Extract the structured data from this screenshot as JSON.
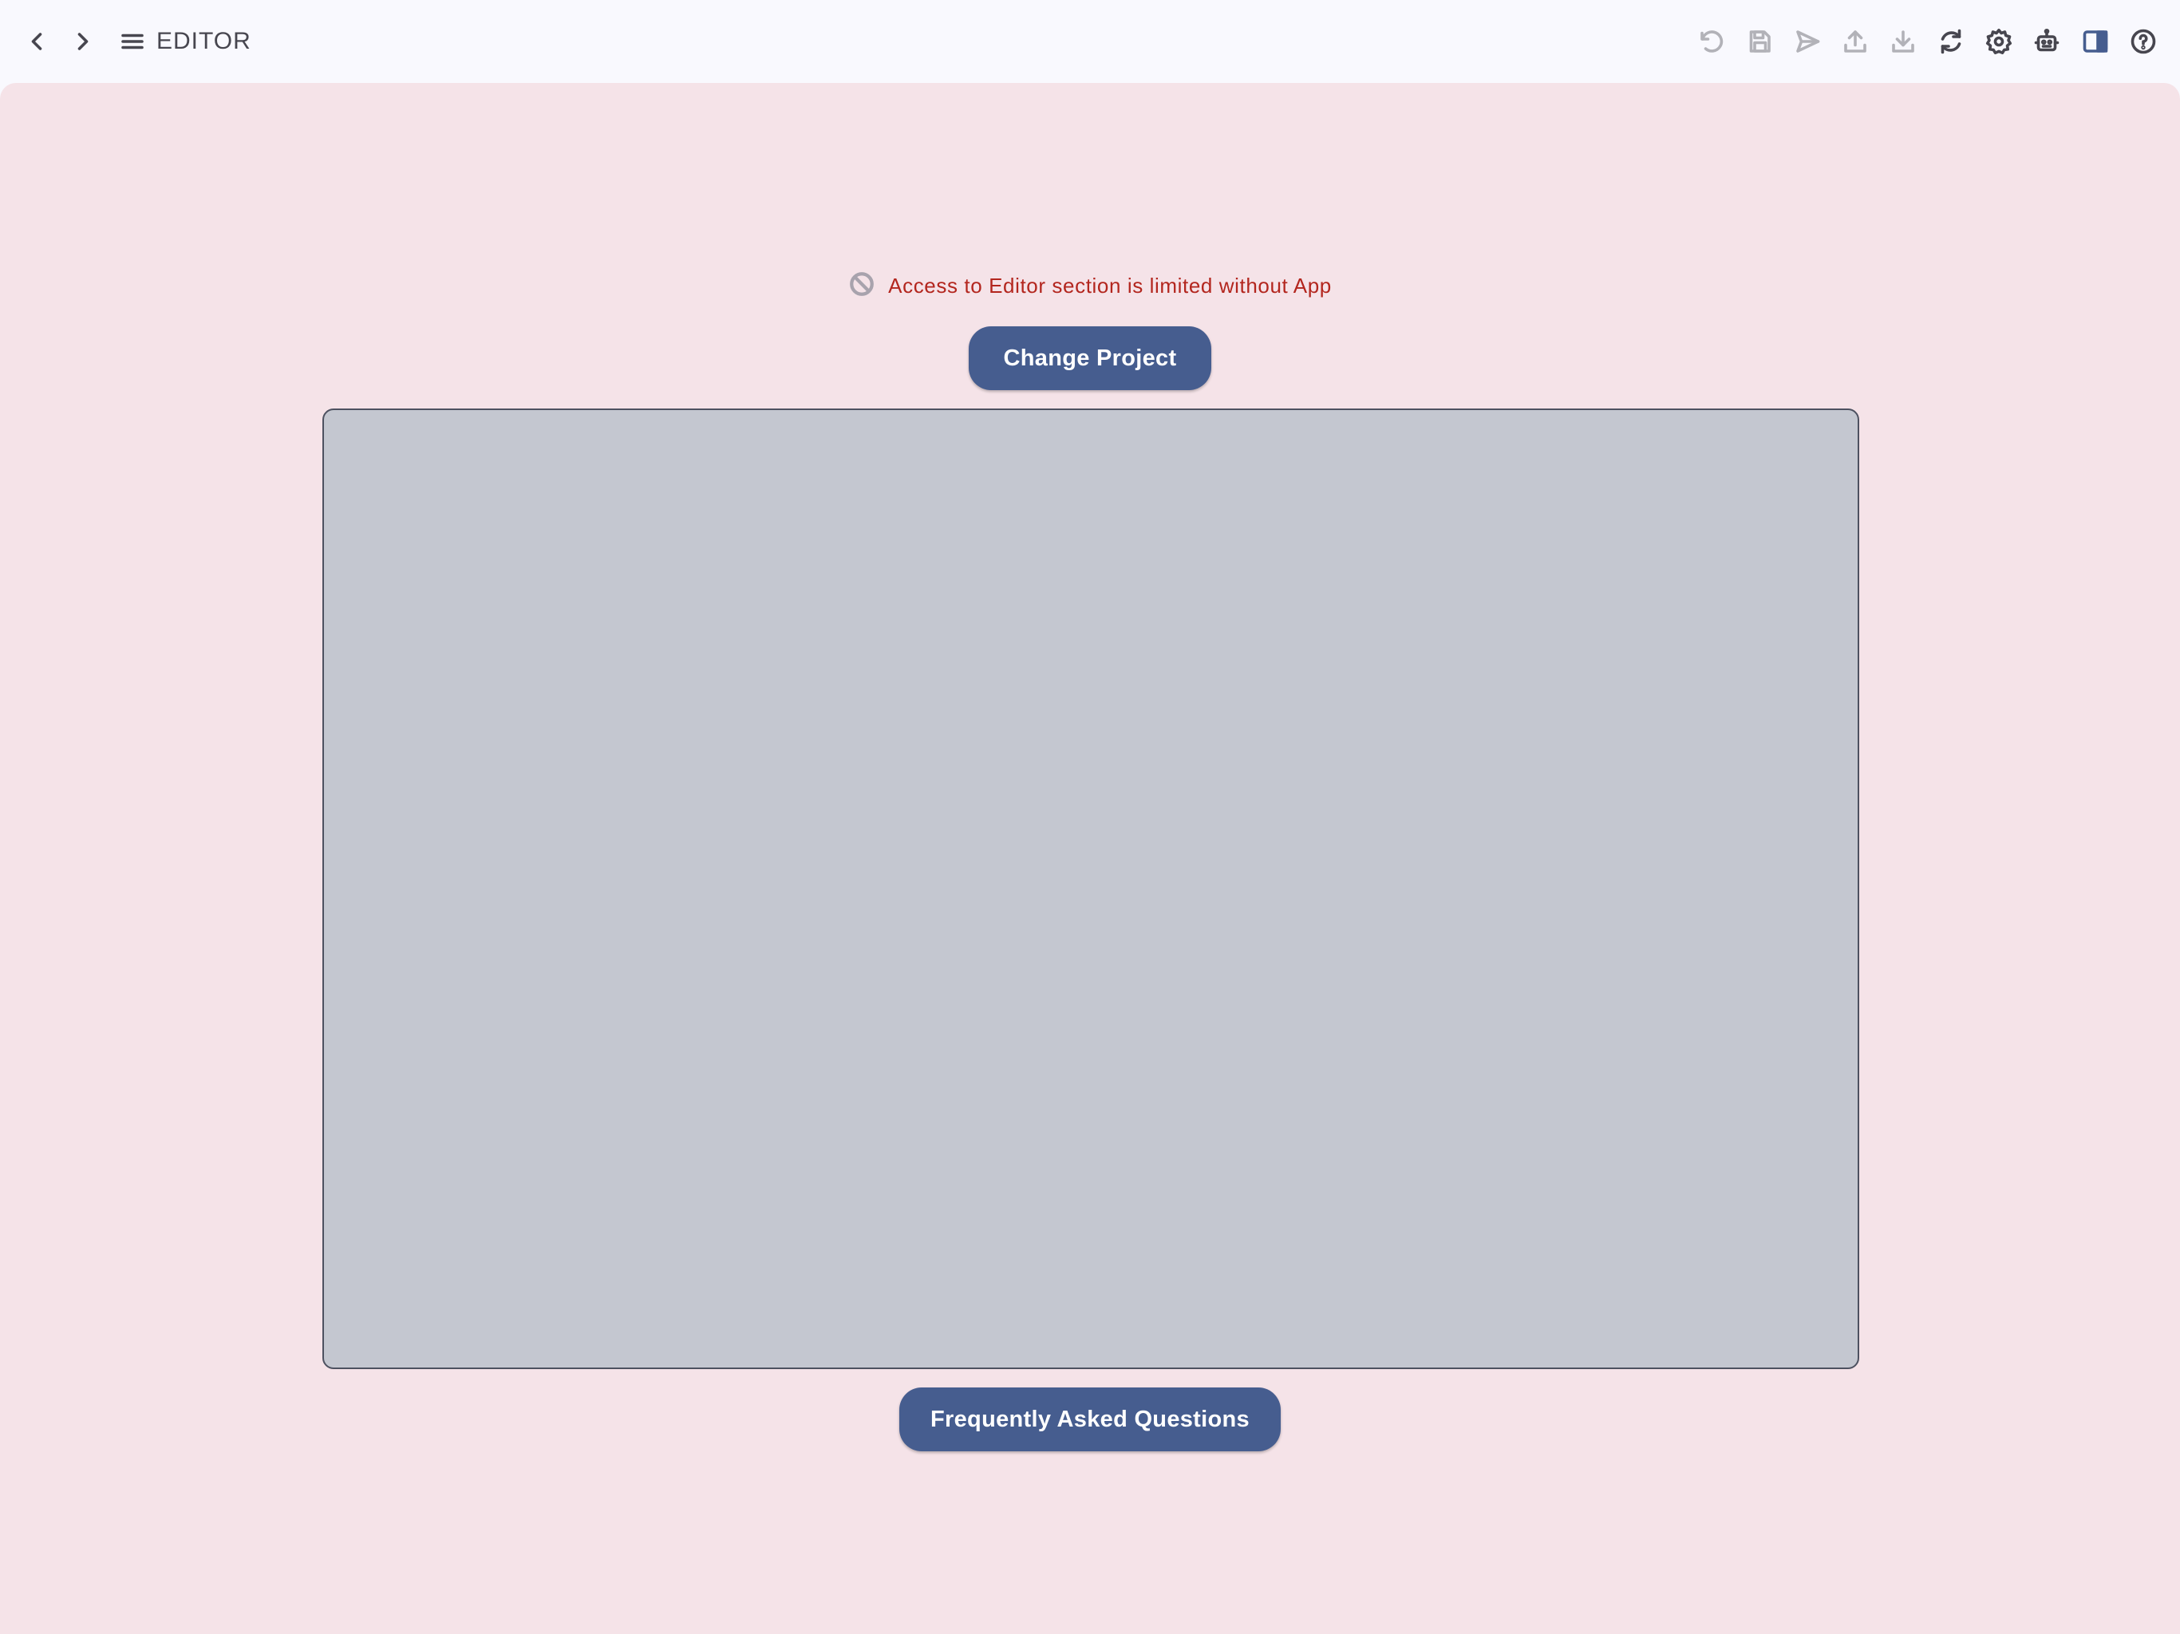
{
  "topbar": {
    "title": "EDITOR",
    "left_icons": [
      "chevron-left-icon",
      "chevron-right-icon",
      "menu-icon"
    ],
    "right_icons": [
      {
        "name": "undo-icon",
        "enabled": false
      },
      {
        "name": "save-icon",
        "enabled": false
      },
      {
        "name": "send-icon",
        "enabled": false
      },
      {
        "name": "upload-icon",
        "enabled": false
      },
      {
        "name": "download-icon",
        "enabled": false
      },
      {
        "name": "refresh-icon",
        "enabled": true
      },
      {
        "name": "gear-icon",
        "enabled": true
      },
      {
        "name": "robot-icon",
        "enabled": true
      },
      {
        "name": "side-panel-icon",
        "enabled": true
      },
      {
        "name": "help-icon",
        "enabled": true
      }
    ]
  },
  "main": {
    "warning_icon": "block-icon",
    "warning_text": "Access to Editor section is limited without App",
    "change_project_label": "Change Project",
    "faq_label": "Frequently Asked Questions"
  },
  "colors": {
    "topbar_bg": "#f9f9fe",
    "main_bg": "#f5e3e8",
    "accent": "#465d8f",
    "warning": "#b3261e",
    "preview_bg": "#c4c7d0"
  }
}
